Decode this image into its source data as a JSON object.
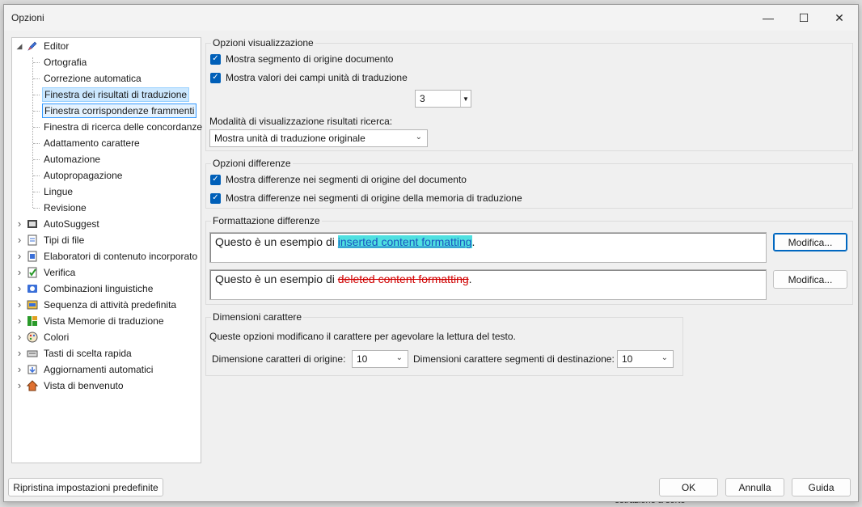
{
  "dialog": {
    "title": "Opzioni"
  },
  "background": {
    "bottom_text": "estrazione a sorte"
  },
  "tree": {
    "root": "Editor",
    "children": [
      "Ortografia",
      "Correzione automatica",
      "Finestra dei risultati di traduzione",
      "Finestra corrispondenze frammenti",
      "Finestra di ricerca delle concordanze",
      "Adattamento carattere",
      "Automazione",
      "Autopropagazione",
      "Lingue",
      "Revisione"
    ],
    "top_items": [
      {
        "label": "AutoSuggest",
        "icon": "autosuggest-icon"
      },
      {
        "label": "Tipi di file",
        "icon": "file-types-icon"
      },
      {
        "label": "Elaboratori di contenuto incorporato",
        "icon": "embedded-content-icon"
      },
      {
        "label": "Verifica",
        "icon": "verification-icon"
      },
      {
        "label": "Combinazioni linguistiche",
        "icon": "language-pairs-icon"
      },
      {
        "label": "Sequenza di attività predefinita",
        "icon": "task-sequence-icon"
      },
      {
        "label": "Vista Memorie di traduzione",
        "icon": "tm-view-icon"
      },
      {
        "label": "Colori",
        "icon": "palette-icon"
      },
      {
        "label": "Tasti di scelta rapida",
        "icon": "keyboard-icon"
      },
      {
        "label": "Aggiornamenti automatici",
        "icon": "updates-icon"
      },
      {
        "label": "Vista di benvenuto",
        "icon": "home-icon"
      }
    ]
  },
  "display": {
    "title": "Opzioni visualizzazione",
    "cb1": "Mostra segmento di origine documento",
    "cb2": "Mostra valori dei campi unità di traduzione",
    "spin_value": "3",
    "mode_label": "Modalità di visualizzazione risultati ricerca:",
    "mode_value": "Mostra unità di traduzione originale"
  },
  "diff": {
    "title": "Opzioni differenze",
    "cb1": "Mostra differenze nei segmenti di origine del documento",
    "cb2": "Mostra differenze nei segmenti di origine della memoria di traduzione"
  },
  "format": {
    "title": "Formattazione differenze",
    "prefix": "Questo è un esempio di ",
    "inserted": "inserted content formatting",
    "deleted": "deleted content formatting",
    "suffix": ".",
    "modify_label": "Modifica..."
  },
  "font": {
    "title": "Dimensioni carattere",
    "desc": "Queste opzioni modificano il carattere per agevolare la lettura del testo.",
    "source_label": "Dimensione caratteri di origine:",
    "source_value": "10",
    "target_label": "Dimensioni carattere segmenti di destinazione:",
    "target_value": "10"
  },
  "footer": {
    "reset": "Ripristina impostazioni predefinite",
    "ok": "OK",
    "cancel": "Annulla",
    "help": "Guida"
  }
}
